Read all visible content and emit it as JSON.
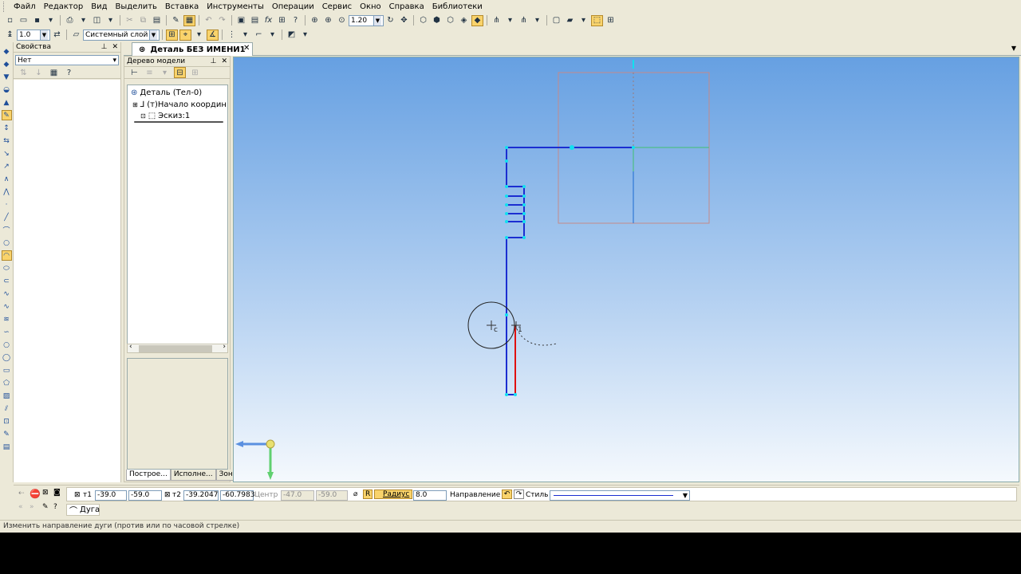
{
  "menu": [
    "Файл",
    "Редактор",
    "Вид",
    "Выделить",
    "Вставка",
    "Инструменты",
    "Операции",
    "Сервис",
    "Окно",
    "Справка",
    "Библиотеки"
  ],
  "toolbar": {
    "zoom_value": "1.20",
    "fx_label": "fx",
    "line_scale": "1.0",
    "layer": "Системный слой"
  },
  "properties_panel": {
    "title": "Свойства",
    "selector_value": "Нет"
  },
  "model_tree": {
    "title": "Дерево модели",
    "nodes": [
      "Деталь (Тел-0)",
      "(т)Начало координ",
      "Эскиз:1"
    ],
    "tabs": [
      "Построе...",
      "Исполне...",
      "Зоны"
    ]
  },
  "document": {
    "tab_title": "Деталь БЕЗ ИМЕНИ1"
  },
  "command_panel": {
    "t1_label": "т1",
    "t1_x": "-39.0",
    "t1_y": "-59.0",
    "t2_label": "т2",
    "t2_x": "-39.2047",
    "t2_y": "-60.7983",
    "center_label": "Центр",
    "center_x": "-47.0",
    "center_y": "-59.0",
    "r_toggle": "R",
    "radius_label": "Радиус",
    "radius_value": "8.0",
    "direction_label": "Направление",
    "style_label": "Стиль",
    "command_name": "Дуга"
  },
  "sketch_markers": {
    "point1": "1",
    "center": "c"
  },
  "status": {
    "hint": "Изменить направление дуги (против или по часовой стрелке)"
  },
  "colors": {
    "sketch_line": "#1b2ed1",
    "active_segment": "#e01010",
    "viewport_top": "#66a0e2",
    "highlight": "#f9d36b"
  }
}
